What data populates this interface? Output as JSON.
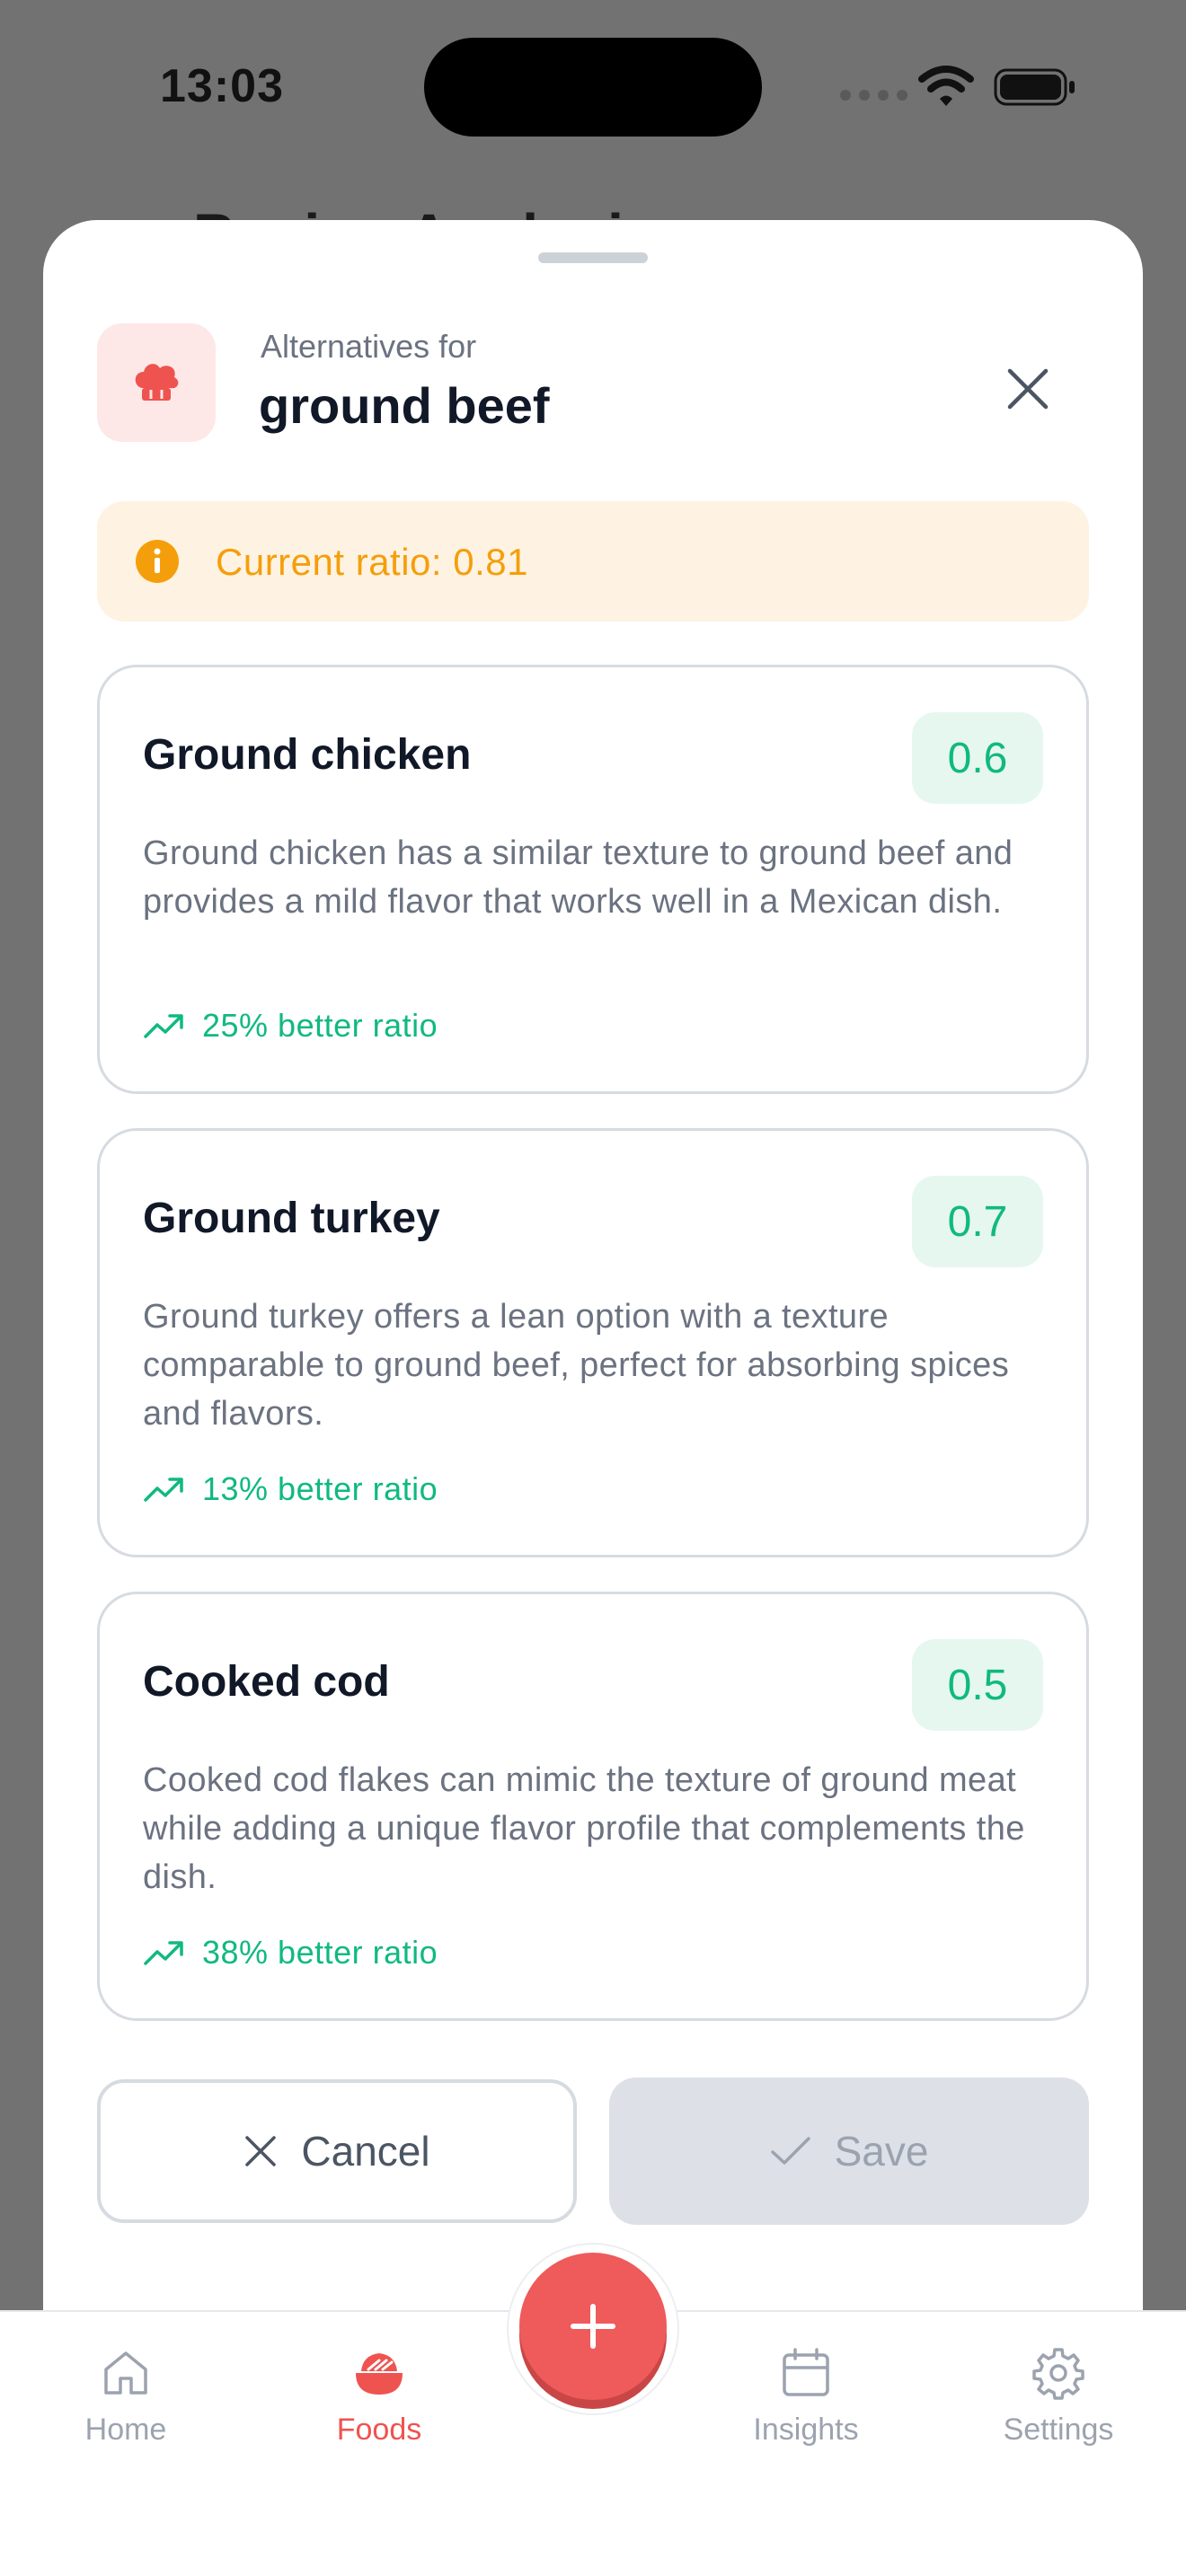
{
  "status_bar": {
    "time": "13:03"
  },
  "background_page": {
    "title": "Recipe Analysis"
  },
  "sheet": {
    "subtitle": "Alternatives for",
    "ingredient": "ground beef",
    "current_ratio": "Current ratio: 0.81"
  },
  "alternatives": [
    {
      "name": "Ground chicken",
      "ratio": "0.6",
      "description": "Ground chicken has a similar texture to ground beef and provides a mild flavor that works well in a Mexican dish.",
      "improvement": "25% better ratio"
    },
    {
      "name": "Ground turkey",
      "ratio": "0.7",
      "description": "Ground turkey offers a lean option with a texture comparable to ground beef, perfect for absorbing spices and flavors.",
      "improvement": "13% better ratio"
    },
    {
      "name": "Cooked cod",
      "ratio": "0.5",
      "description": "Cooked cod flakes can mimic the texture of ground meat while adding a unique flavor profile that complements the dish.",
      "improvement": "38% better ratio"
    }
  ],
  "actions": {
    "cancel": "Cancel",
    "save": "Save"
  },
  "tab_bar": {
    "items": [
      {
        "label": "Home",
        "icon": "home-icon"
      },
      {
        "label": "Foods",
        "icon": "bowl-icon",
        "active": true
      },
      {
        "label": "Insights",
        "icon": "calendar-icon"
      },
      {
        "label": "Settings",
        "icon": "gear-icon"
      }
    ],
    "fab_icon": "plus-icon"
  },
  "colors": {
    "accent": "#ef5350",
    "success": "#10b981",
    "warning": "#f59e0b",
    "overlay": "#727272"
  }
}
